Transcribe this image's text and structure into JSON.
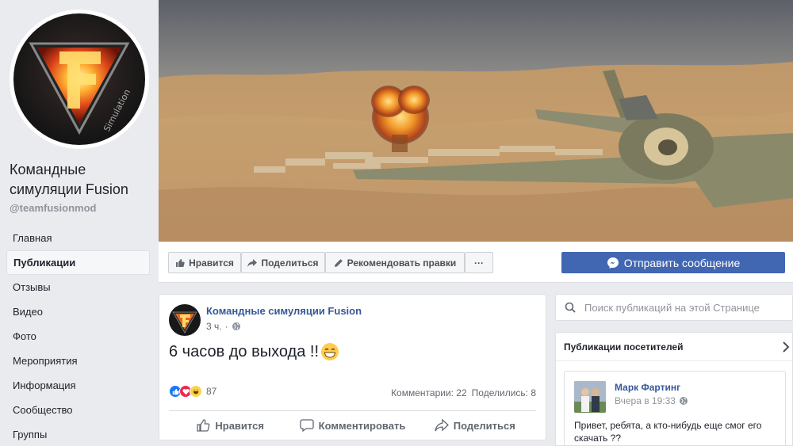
{
  "page": {
    "name": "Командные симуляции Fusion",
    "handle": "@teamfusionmod",
    "logo_text": "Simulation"
  },
  "nav": {
    "items": [
      {
        "label": "Главная"
      },
      {
        "label": "Публикации"
      },
      {
        "label": "Отзывы"
      },
      {
        "label": "Видео"
      },
      {
        "label": "Фото"
      },
      {
        "label": "Мероприятия"
      },
      {
        "label": "Информация"
      },
      {
        "label": "Сообщество"
      },
      {
        "label": "Группы"
      }
    ],
    "active_index": 1
  },
  "actions": {
    "like": "Нравится",
    "share": "Поделиться",
    "suggest": "Рекомендовать правки",
    "more": "···",
    "send_message": "Отправить сообщение"
  },
  "post": {
    "author": "Командные симуляции Fusion",
    "time": "3 ч.",
    "text": "6 часов до выхода !!",
    "reactions_count": "87",
    "comments": "Комментарии: 22",
    "shares": "Поделились: 8",
    "like_label": "Нравится",
    "comment_label": "Комментировать",
    "share_label": "Поделиться"
  },
  "search": {
    "placeholder": "Поиск публикаций на этой Странице"
  },
  "visitor_posts": {
    "title": "Публикации посетителей",
    "item": {
      "author": "Марк Фартинг",
      "time": "Вчера в 19:33",
      "text": "Привет, ребята, а кто-нибудь еще смог его скачать ??"
    }
  },
  "colors": {
    "brand_blue": "#4267b2",
    "link_blue": "#365899",
    "background": "#e9ebee"
  }
}
